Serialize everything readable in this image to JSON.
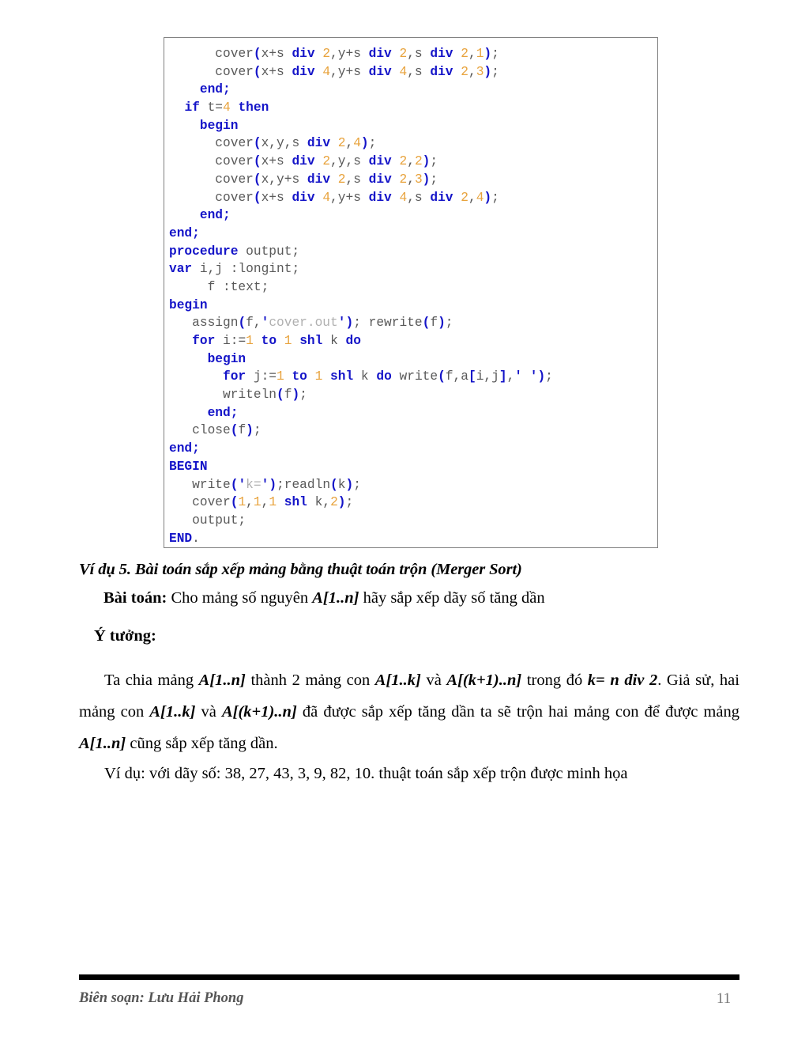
{
  "page": {
    "number": "11",
    "footer_author": "Biên soạn: Lưu Hải Phong"
  },
  "code_block": {
    "language": "Pascal",
    "colors": {
      "keyword": "#1414c8",
      "number": "#e8a33d",
      "identifier": "#595959",
      "string": "#b0b0b0",
      "border": "#808080",
      "background": "#ffffff"
    },
    "lines": [
      [
        {
          "t": "      ",
          "c": "id"
        },
        {
          "t": "cover",
          "c": "id"
        },
        {
          "t": "(",
          "c": "pn"
        },
        {
          "t": "x+s ",
          "c": "id"
        },
        {
          "t": "div",
          "c": "kw"
        },
        {
          "t": " ",
          "c": "id"
        },
        {
          "t": "2",
          "c": "num"
        },
        {
          "t": ",y+s ",
          "c": "id"
        },
        {
          "t": "div",
          "c": "kw"
        },
        {
          "t": " ",
          "c": "id"
        },
        {
          "t": "2",
          "c": "num"
        },
        {
          "t": ",s ",
          "c": "id"
        },
        {
          "t": "div",
          "c": "kw"
        },
        {
          "t": " ",
          "c": "id"
        },
        {
          "t": "2",
          "c": "num"
        },
        {
          "t": ",",
          "c": "id"
        },
        {
          "t": "1",
          "c": "num"
        },
        {
          "t": ")",
          "c": "pn"
        },
        {
          "t": ";",
          "c": "id"
        }
      ],
      [
        {
          "t": "      ",
          "c": "id"
        },
        {
          "t": "cover",
          "c": "id"
        },
        {
          "t": "(",
          "c": "pn"
        },
        {
          "t": "x+s ",
          "c": "id"
        },
        {
          "t": "div",
          "c": "kw"
        },
        {
          "t": " ",
          "c": "id"
        },
        {
          "t": "4",
          "c": "num"
        },
        {
          "t": ",y+s ",
          "c": "id"
        },
        {
          "t": "div",
          "c": "kw"
        },
        {
          "t": " ",
          "c": "id"
        },
        {
          "t": "4",
          "c": "num"
        },
        {
          "t": ",s ",
          "c": "id"
        },
        {
          "t": "div",
          "c": "kw"
        },
        {
          "t": " ",
          "c": "id"
        },
        {
          "t": "2",
          "c": "num"
        },
        {
          "t": ",",
          "c": "id"
        },
        {
          "t": "3",
          "c": "num"
        },
        {
          "t": ")",
          "c": "pn"
        },
        {
          "t": ";",
          "c": "id"
        }
      ],
      [
        {
          "t": "    ",
          "c": "id"
        },
        {
          "t": "end;",
          "c": "kw"
        }
      ],
      [
        {
          "t": "  ",
          "c": "id"
        },
        {
          "t": "if",
          "c": "kw"
        },
        {
          "t": " t=",
          "c": "id"
        },
        {
          "t": "4",
          "c": "num"
        },
        {
          "t": " ",
          "c": "id"
        },
        {
          "t": "then",
          "c": "kw"
        }
      ],
      [
        {
          "t": "    ",
          "c": "id"
        },
        {
          "t": "begin",
          "c": "kw"
        }
      ],
      [
        {
          "t": "      ",
          "c": "id"
        },
        {
          "t": "cover",
          "c": "id"
        },
        {
          "t": "(",
          "c": "pn"
        },
        {
          "t": "x,y,s ",
          "c": "id"
        },
        {
          "t": "div",
          "c": "kw"
        },
        {
          "t": " ",
          "c": "id"
        },
        {
          "t": "2",
          "c": "num"
        },
        {
          "t": ",",
          "c": "id"
        },
        {
          "t": "4",
          "c": "num"
        },
        {
          "t": ")",
          "c": "pn"
        },
        {
          "t": ";",
          "c": "id"
        }
      ],
      [
        {
          "t": "      ",
          "c": "id"
        },
        {
          "t": "cover",
          "c": "id"
        },
        {
          "t": "(",
          "c": "pn"
        },
        {
          "t": "x+s ",
          "c": "id"
        },
        {
          "t": "div",
          "c": "kw"
        },
        {
          "t": " ",
          "c": "id"
        },
        {
          "t": "2",
          "c": "num"
        },
        {
          "t": ",y,s ",
          "c": "id"
        },
        {
          "t": "div",
          "c": "kw"
        },
        {
          "t": " ",
          "c": "id"
        },
        {
          "t": "2",
          "c": "num"
        },
        {
          "t": ",",
          "c": "id"
        },
        {
          "t": "2",
          "c": "num"
        },
        {
          "t": ")",
          "c": "pn"
        },
        {
          "t": ";",
          "c": "id"
        }
      ],
      [
        {
          "t": "      ",
          "c": "id"
        },
        {
          "t": "cover",
          "c": "id"
        },
        {
          "t": "(",
          "c": "pn"
        },
        {
          "t": "x,y+s ",
          "c": "id"
        },
        {
          "t": "div",
          "c": "kw"
        },
        {
          "t": " ",
          "c": "id"
        },
        {
          "t": "2",
          "c": "num"
        },
        {
          "t": ",s ",
          "c": "id"
        },
        {
          "t": "div",
          "c": "kw"
        },
        {
          "t": " ",
          "c": "id"
        },
        {
          "t": "2",
          "c": "num"
        },
        {
          "t": ",",
          "c": "id"
        },
        {
          "t": "3",
          "c": "num"
        },
        {
          "t": ")",
          "c": "pn"
        },
        {
          "t": ";",
          "c": "id"
        }
      ],
      [
        {
          "t": "      ",
          "c": "id"
        },
        {
          "t": "cover",
          "c": "id"
        },
        {
          "t": "(",
          "c": "pn"
        },
        {
          "t": "x+s ",
          "c": "id"
        },
        {
          "t": "div",
          "c": "kw"
        },
        {
          "t": " ",
          "c": "id"
        },
        {
          "t": "4",
          "c": "num"
        },
        {
          "t": ",y+s ",
          "c": "id"
        },
        {
          "t": "div",
          "c": "kw"
        },
        {
          "t": " ",
          "c": "id"
        },
        {
          "t": "4",
          "c": "num"
        },
        {
          "t": ",s ",
          "c": "id"
        },
        {
          "t": "div",
          "c": "kw"
        },
        {
          "t": " ",
          "c": "id"
        },
        {
          "t": "2",
          "c": "num"
        },
        {
          "t": ",",
          "c": "id"
        },
        {
          "t": "4",
          "c": "num"
        },
        {
          "t": ")",
          "c": "pn"
        },
        {
          "t": ";",
          "c": "id"
        }
      ],
      [
        {
          "t": "    ",
          "c": "id"
        },
        {
          "t": "end;",
          "c": "kw"
        }
      ],
      [
        {
          "t": "end;",
          "c": "kw"
        }
      ],
      [
        {
          "t": "procedure",
          "c": "kw"
        },
        {
          "t": " output;",
          "c": "id"
        }
      ],
      [
        {
          "t": "var",
          "c": "kw"
        },
        {
          "t": " i,j :longint;",
          "c": "id"
        }
      ],
      [
        {
          "t": "     f :text;",
          "c": "id"
        }
      ],
      [
        {
          "t": "begin",
          "c": "kw"
        }
      ],
      [
        {
          "t": "   assign",
          "c": "id"
        },
        {
          "t": "(",
          "c": "pn"
        },
        {
          "t": "f,",
          "c": "id"
        },
        {
          "t": "'",
          "c": "pn"
        },
        {
          "t": "cover.out",
          "c": "str"
        },
        {
          "t": "'",
          "c": "pn"
        },
        {
          "t": ")",
          "c": "pn"
        },
        {
          "t": "; rewrite",
          "c": "id"
        },
        {
          "t": "(",
          "c": "pn"
        },
        {
          "t": "f",
          "c": "id"
        },
        {
          "t": ")",
          "c": "pn"
        },
        {
          "t": ";",
          "c": "id"
        }
      ],
      [
        {
          "t": "   ",
          "c": "id"
        },
        {
          "t": "for",
          "c": "kw"
        },
        {
          "t": " i:=",
          "c": "id"
        },
        {
          "t": "1",
          "c": "num"
        },
        {
          "t": " ",
          "c": "id"
        },
        {
          "t": "to",
          "c": "kw"
        },
        {
          "t": " ",
          "c": "id"
        },
        {
          "t": "1",
          "c": "num"
        },
        {
          "t": " ",
          "c": "id"
        },
        {
          "t": "shl",
          "c": "kw"
        },
        {
          "t": " k ",
          "c": "id"
        },
        {
          "t": "do",
          "c": "kw"
        }
      ],
      [
        {
          "t": "     ",
          "c": "id"
        },
        {
          "t": "begin",
          "c": "kw"
        }
      ],
      [
        {
          "t": "       ",
          "c": "id"
        },
        {
          "t": "for",
          "c": "kw"
        },
        {
          "t": " j:=",
          "c": "id"
        },
        {
          "t": "1",
          "c": "num"
        },
        {
          "t": " ",
          "c": "id"
        },
        {
          "t": "to",
          "c": "kw"
        },
        {
          "t": " ",
          "c": "id"
        },
        {
          "t": "1",
          "c": "num"
        },
        {
          "t": " ",
          "c": "id"
        },
        {
          "t": "shl",
          "c": "kw"
        },
        {
          "t": " k ",
          "c": "id"
        },
        {
          "t": "do",
          "c": "kw"
        },
        {
          "t": " write",
          "c": "id"
        },
        {
          "t": "(",
          "c": "pn"
        },
        {
          "t": "f,a",
          "c": "id"
        },
        {
          "t": "[",
          "c": "pn"
        },
        {
          "t": "i,j",
          "c": "id"
        },
        {
          "t": "]",
          "c": "pn"
        },
        {
          "t": ",",
          "c": "id"
        },
        {
          "t": "'",
          "c": "pn"
        },
        {
          "t": " ",
          "c": "str"
        },
        {
          "t": "'",
          "c": "pn"
        },
        {
          "t": ")",
          "c": "pn"
        },
        {
          "t": ";",
          "c": "id"
        }
      ],
      [
        {
          "t": "       writeln",
          "c": "id"
        },
        {
          "t": "(",
          "c": "pn"
        },
        {
          "t": "f",
          "c": "id"
        },
        {
          "t": ")",
          "c": "pn"
        },
        {
          "t": ";",
          "c": "id"
        }
      ],
      [
        {
          "t": "     ",
          "c": "id"
        },
        {
          "t": "end;",
          "c": "kw"
        }
      ],
      [
        {
          "t": "   close",
          "c": "id"
        },
        {
          "t": "(",
          "c": "pn"
        },
        {
          "t": "f",
          "c": "id"
        },
        {
          "t": ")",
          "c": "pn"
        },
        {
          "t": ";",
          "c": "id"
        }
      ],
      [
        {
          "t": "end;",
          "c": "kw"
        }
      ],
      [
        {
          "t": "BEGIN",
          "c": "kw"
        }
      ],
      [
        {
          "t": "   write",
          "c": "id"
        },
        {
          "t": "(",
          "c": "pn"
        },
        {
          "t": "'",
          "c": "pn"
        },
        {
          "t": "k=",
          "c": "str"
        },
        {
          "t": "'",
          "c": "pn"
        },
        {
          "t": ")",
          "c": "pn"
        },
        {
          "t": ";readln",
          "c": "id"
        },
        {
          "t": "(",
          "c": "pn"
        },
        {
          "t": "k",
          "c": "id"
        },
        {
          "t": ")",
          "c": "pn"
        },
        {
          "t": ";",
          "c": "id"
        }
      ],
      [
        {
          "t": "   cover",
          "c": "id"
        },
        {
          "t": "(",
          "c": "pn"
        },
        {
          "t": "1",
          "c": "num"
        },
        {
          "t": ",",
          "c": "id"
        },
        {
          "t": "1",
          "c": "num"
        },
        {
          "t": ",",
          "c": "id"
        },
        {
          "t": "1",
          "c": "num"
        },
        {
          "t": " ",
          "c": "id"
        },
        {
          "t": "shl",
          "c": "kw"
        },
        {
          "t": " k,",
          "c": "id"
        },
        {
          "t": "2",
          "c": "num"
        },
        {
          "t": ")",
          "c": "pn"
        },
        {
          "t": ";",
          "c": "id"
        }
      ],
      [
        {
          "t": "   output;",
          "c": "id"
        }
      ],
      [
        {
          "t": "END",
          "c": "kw"
        },
        {
          "t": ".",
          "c": "id"
        }
      ]
    ]
  },
  "content": {
    "example_heading": "Ví dụ 5. Bài toán sắp xếp mảng bằng thuật toán trộn (Merger Sort)",
    "problem_label": "Bài toán:",
    "problem_text_a": " Cho mảng số nguyên ",
    "problem_array": "A[1..n]",
    "problem_text_b": " hãy sắp xếp dãy số tăng dần",
    "idea_label": "Ý tưởng:",
    "idea_paragraph": {
      "s1": "Ta chia mảng ",
      "v1": "A[1..n]",
      "s2": " thành 2 mảng con ",
      "v2": "A[1..k]",
      "s3": " và ",
      "v3": "A[(k+1)..n]",
      "s4": " trong đó ",
      "v4": "k= n div 2",
      "s5": ". Giả sử, hai mảng con ",
      "v5": "A[1..k]",
      "s6": " và ",
      "v6": "A[(k+1)..n]",
      "s7": " đã được sắp xếp tăng dần ta sẽ trộn hai mảng con để được mảng ",
      "v7": "A[1..n]",
      "s8": " cũng sắp xếp tăng dần."
    },
    "example_paragraph": "Ví dụ: với dãy số: 38, 27, 43, 3, 9, 82, 10. thuật toán sắp xếp trộn được minh họa",
    "example_sequence": [
      38,
      27,
      43,
      3,
      9,
      82,
      10
    ]
  }
}
